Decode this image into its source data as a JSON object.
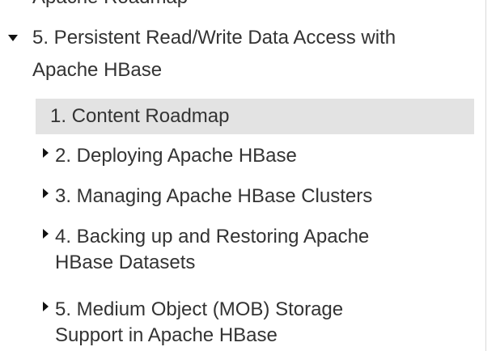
{
  "toc": {
    "clipped_text": "Apache Roadmap",
    "section": {
      "line1": "5. Persistent Read/Write Data Access with",
      "line2": "Apache HBase"
    },
    "items": [
      {
        "label": "1. Content Roadmap"
      },
      {
        "label": "2. Deploying Apache HBase"
      },
      {
        "label": "3. Managing Apache HBase Clusters"
      },
      {
        "line1": "4. Backing up and Restoring Apache",
        "line2": "HBase Datasets"
      },
      {
        "line1": "5. Medium Object (MOB) Storage",
        "line2": "Support in Apache HBase"
      }
    ]
  },
  "colors": {
    "text": "#333333",
    "selected_bg": "#e3e3e3",
    "caret": "#111111"
  },
  "icons": {
    "expanded": "caret-down-icon",
    "collapsed": "caret-right-icon"
  }
}
